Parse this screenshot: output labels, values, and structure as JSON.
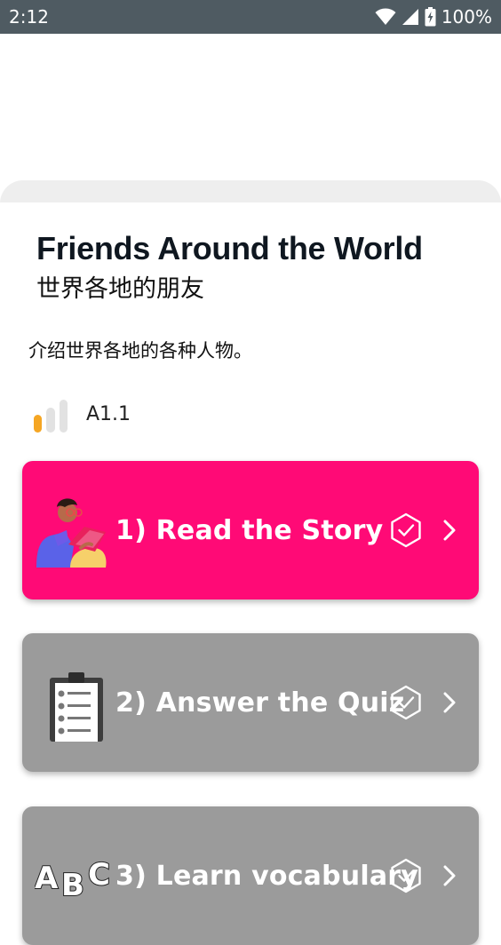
{
  "status_bar": {
    "time": "2:12",
    "battery": "100%",
    "icons": [
      "wifi-icon",
      "signal-icon",
      "battery-icon"
    ]
  },
  "lesson": {
    "title": "Friends Around the World",
    "subtitle": "世界各地的朋友",
    "description": "介绍世界各地的各种人物。",
    "level": "A1.1",
    "level_fill": 1,
    "level_total": 3
  },
  "steps": [
    {
      "label": "1) Read the Story",
      "icon": "reading-person-illustration",
      "color": "#ff0a76",
      "completed": false
    },
    {
      "label": "2) Answer the Quiz",
      "icon": "clipboard-checklist-illustration",
      "color": "#9b9b9b",
      "completed": false
    },
    {
      "label": "3) Learn vocabulary",
      "icon": "abc-letters-illustration",
      "color": "#9b9b9b",
      "completed": false
    }
  ],
  "colors": {
    "status_bar": "#4f5b62",
    "accent": "#ff0a76",
    "inactive": "#9b9b9b",
    "level_active": "#f5a623",
    "level_inactive": "#e2e2e2"
  }
}
